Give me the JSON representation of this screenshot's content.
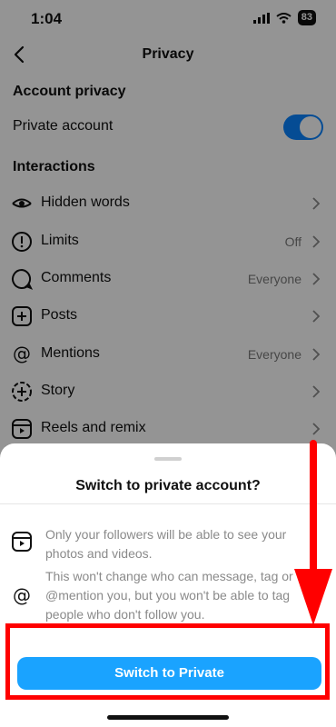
{
  "status_bar": {
    "time": "1:04",
    "battery": "83"
  },
  "nav": {
    "title": "Privacy"
  },
  "sections": {
    "account_privacy": "Account privacy",
    "interactions": "Interactions"
  },
  "private_account": {
    "label": "Private account",
    "enabled": true
  },
  "items": [
    {
      "label": "Hidden words",
      "value": ""
    },
    {
      "label": "Limits",
      "value": "Off"
    },
    {
      "label": "Comments",
      "value": "Everyone"
    },
    {
      "label": "Posts",
      "value": ""
    },
    {
      "label": "Mentions",
      "value": "Everyone"
    },
    {
      "label": "Story",
      "value": ""
    },
    {
      "label": "Reels and remix",
      "value": ""
    }
  ],
  "sheet": {
    "title": "Switch to private account?",
    "info": [
      "Only your followers will be able to see your photos and videos.",
      "This won't change who can message, tag or @mention you, but you won't be able to tag people who don't follow you."
    ],
    "primary_button": "Switch to Private"
  },
  "colors": {
    "accent": "#1aa3ff",
    "toggle_on": "#0a84ff",
    "annotation": "#ff0000"
  }
}
